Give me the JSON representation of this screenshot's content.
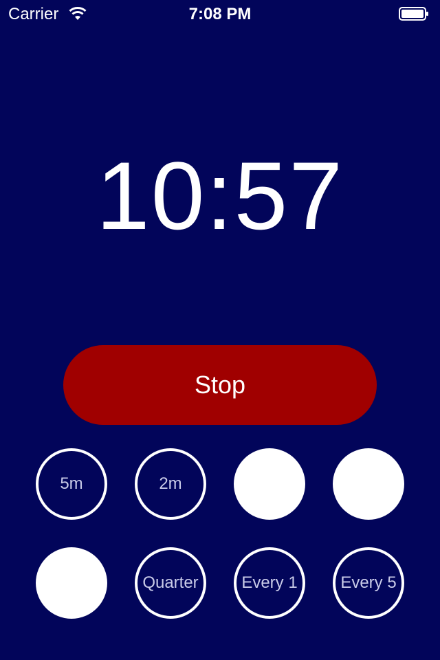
{
  "status_bar": {
    "carrier": "Carrier",
    "time": "7:08 PM",
    "icons": [
      "wifi-icon",
      "battery-icon"
    ]
  },
  "timer": {
    "display": "10:57"
  },
  "controls": {
    "stop_label": "Stop",
    "buttons_row1": [
      "5m",
      "2m",
      "",
      ""
    ],
    "buttons_row2": [
      "",
      "Quarter",
      "Every 1",
      "Every 5"
    ]
  },
  "colors": {
    "background": "#02055a",
    "stop_button": "#a00000",
    "text": "#ffffff",
    "option_text": "#c9cbe8"
  }
}
